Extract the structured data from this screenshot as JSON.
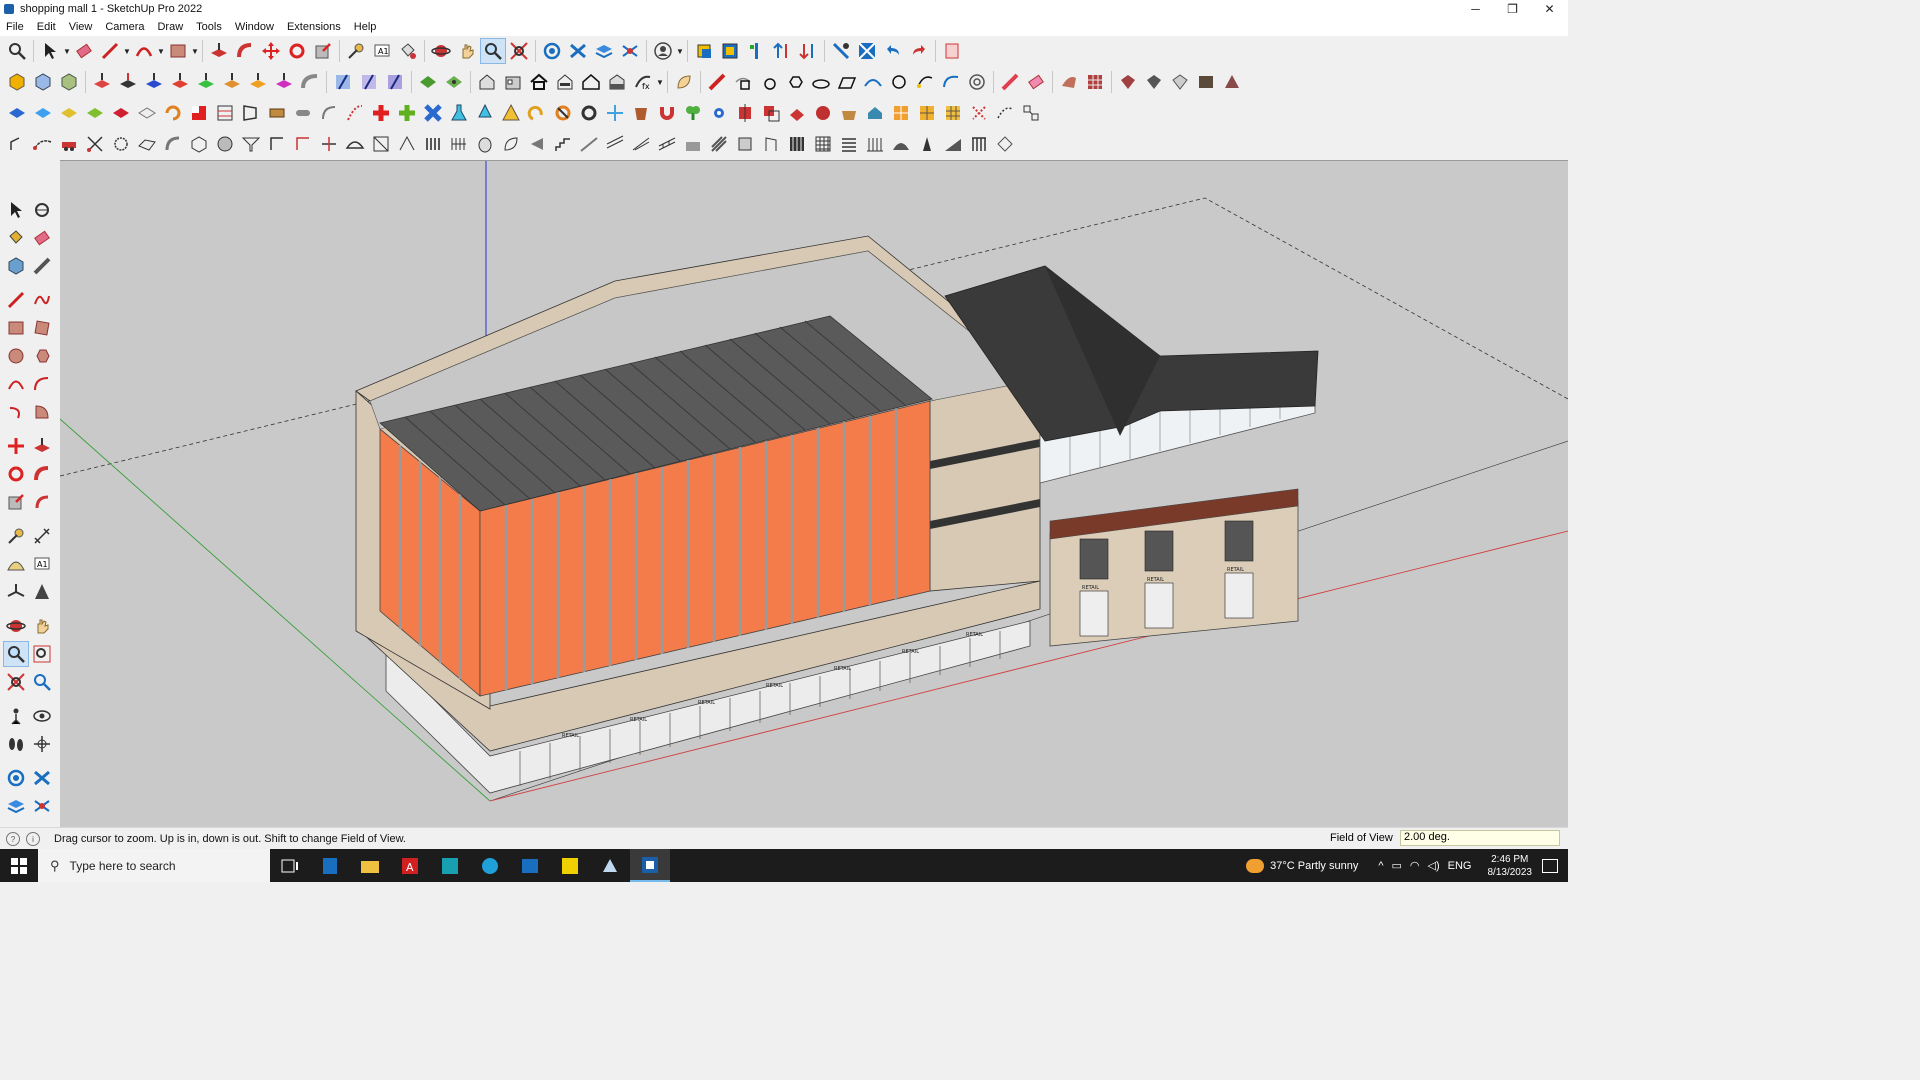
{
  "window": {
    "title": "shopping mall 1 - SketchUp Pro 2022",
    "minimize": "─",
    "maximize": "❐",
    "close": "✕"
  },
  "menu": [
    "File",
    "Edit",
    "View",
    "Camera",
    "Draw",
    "Tools",
    "Window",
    "Extensions",
    "Help"
  ],
  "status": {
    "hint": "Drag cursor to zoom.  Up is in, down is out. Shift to change Field of View.",
    "measure_label": "Field of View",
    "measure_value": "2.00 deg."
  },
  "taskbar": {
    "search_placeholder": "Type here to search",
    "weather": "37°C  Partly sunny",
    "language": "ENG",
    "time": "2:46 PM",
    "date": "8/13/2023"
  },
  "colors": {
    "facade_orange": "#f47c4a",
    "facade_stone": "#d8c9b4",
    "roof_dark": "#3a3a3a",
    "ground": "#c9c9c9",
    "axis_red": "#d04040",
    "axis_green": "#3aa03a",
    "axis_blue": "#3030d0"
  },
  "viewport": {
    "retail_sign": "RETAIL"
  }
}
